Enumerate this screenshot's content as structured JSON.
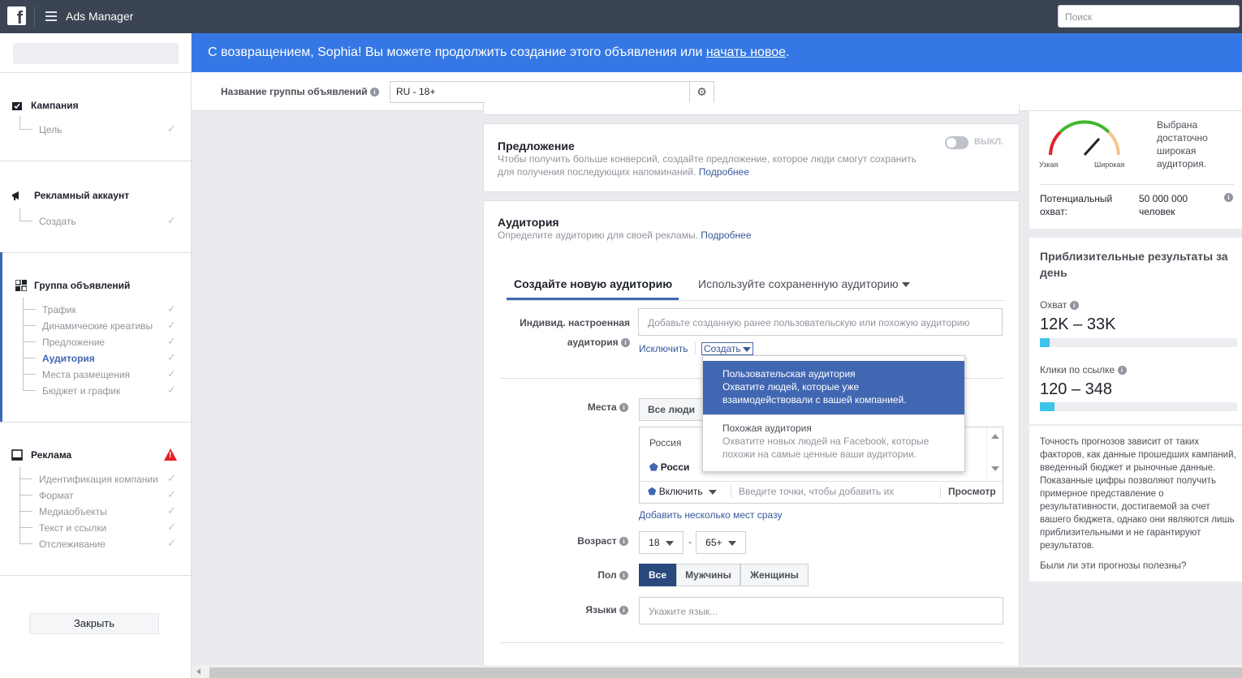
{
  "topbar": {
    "logo": "f",
    "app_title": "Ads Manager",
    "search_placeholder": "Поиск"
  },
  "banner": {
    "text": "С возвращением, Sophia! Вы можете продолжить создание этого объявления или ",
    "link": "начать новое",
    "suffix": "."
  },
  "namebar": {
    "label": "Название группы объявлений",
    "value": "RU - 18+"
  },
  "sidebar": {
    "campaign": {
      "title": "Кампания",
      "items": [
        "Цель"
      ]
    },
    "ad_account": {
      "title": "Рекламный аккаунт",
      "items": [
        "Создать"
      ]
    },
    "adset": {
      "title": "Группа объявлений",
      "items": [
        "Трафик",
        "Динамические креативы",
        "Предложение",
        "Аудитория",
        "Места размещения",
        "Бюджет и график"
      ],
      "active": "Аудитория"
    },
    "ad": {
      "title": "Реклама",
      "items": [
        "Идентификация компании",
        "Формат",
        "Медиаобъекты",
        "Текст и ссылки",
        "Отслеживание"
      ]
    },
    "close_label": "Закрыть"
  },
  "offer": {
    "title": "Предложение",
    "desc": "Чтобы получить больше конверсий, создайте предложение, которое люди смогут сохранить для получения последующих напоминаний. ",
    "link": "Подробнее",
    "toggle_label": "ВЫКЛ."
  },
  "audience": {
    "title": "Аудитория",
    "desc": "Определите аудиторию для своей рекламы. ",
    "link": "Подробнее",
    "tabs": [
      "Создайте новую аудиторию",
      "Используйте сохраненную аудиторию"
    ],
    "custom_label_1": "Индивид. настроенная",
    "custom_label_2": "аудитория",
    "custom_placeholder": "Добавьте созданную ранее пользовательскую или похожую аудиторию",
    "exclude_label": "Исключить",
    "create_label": "Создать",
    "dropdown": [
      {
        "title": "Пользовательская аудитория",
        "desc": "Охватите людей, которые уже взаимодействовали с вашей компанией."
      },
      {
        "title": "Похожая аудитория",
        "desc": "Охватите новых людей на Facebook, которые похожи на самые ценные ваши аудитории."
      }
    ],
    "places_label": "Места",
    "places_btn": "Все люди",
    "places_country": "Россия",
    "places_tag": "Росси",
    "include_label": "Включить",
    "places_input_placeholder": "Введите точки, чтобы добавить их",
    "browse_label": "Просмотр",
    "add_many_link": "Добавить несколько мест сразу",
    "age_label": "Возраст",
    "age_from": "18",
    "age_sep": "-",
    "age_to": "65+",
    "gender_label": "Пол",
    "genders": [
      "Все",
      "Мужчины",
      "Женщины"
    ],
    "gender_selected": "Все",
    "lang_label": "Языки",
    "lang_placeholder": "Укажите язык..."
  },
  "right": {
    "gauge_narrow": "Узкая",
    "gauge_wide": "Широкая",
    "gauge_text": "Выбрана достаточно широкая аудитория.",
    "potential_label": "Потенциальный охват:",
    "potential_value": "50 000 000 человек",
    "results_title": "Приблизительные результаты за день",
    "reach_label": "Охват",
    "reach_value": "12K – 33K",
    "reach_fill": 0.02,
    "clicks_label": "Клики по ссылке",
    "clicks_value": "120 – 348",
    "clicks_fill": 0.04,
    "note": "Точность прогнозов зависит от таких факторов, как данные прошедших кампаний, введенный бюджет и рыночные данные. Показанные цифры позволяют получить примерное представление о результативности, достигаемой за счет вашего бюджета, однако они являются лишь приблизительными и не гарантируют результатов.",
    "feedback_link": "Были ли эти прогнозы полезны?"
  },
  "colors": {
    "topbar": "#3b4453",
    "banner": "#3578e5",
    "accent": "#4267b2",
    "bar": "#3ec4e8",
    "warning": "#e3212b"
  }
}
